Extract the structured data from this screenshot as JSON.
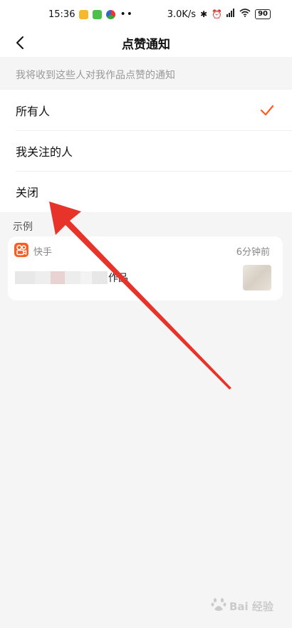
{
  "status_bar": {
    "time": "15:36",
    "network_speed": "3.0K/s",
    "battery": "90",
    "icons": [
      "notification-icon",
      "download-icon",
      "browser-icon",
      "bluetooth-icon",
      "alarm-icon",
      "signal-icon",
      "wifi-icon",
      "battery-icon"
    ]
  },
  "header": {
    "title": "点赞通知",
    "back_icon": "chevron-left-icon"
  },
  "hint": "我将收到这些人对我作品点赞的通知",
  "options": [
    {
      "label": "所有人",
      "selected": true
    },
    {
      "label": "我关注的人",
      "selected": false
    },
    {
      "label": "关闭",
      "selected": false
    }
  ],
  "example": {
    "section_label": "示例",
    "app_name": "快手",
    "time_ago": "6分钟前",
    "message_visible_suffix": "作品"
  },
  "colors": {
    "accent": "#ff5a1f",
    "annotation_arrow": "#e8332b"
  },
  "watermark": {
    "text": "Bai 经验"
  }
}
